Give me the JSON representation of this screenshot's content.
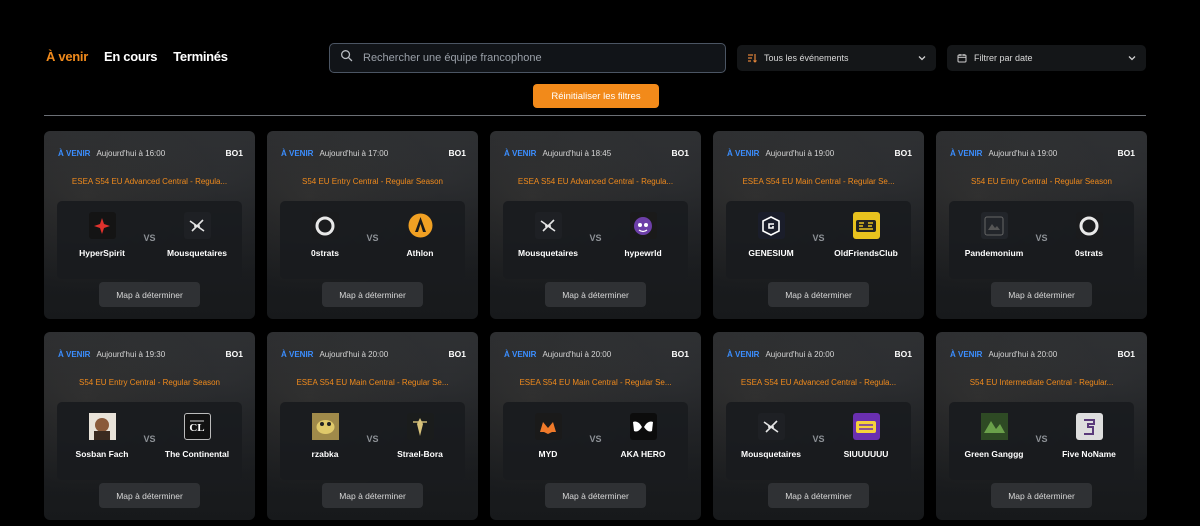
{
  "tabs": [
    {
      "label": "À venir",
      "active": true
    },
    {
      "label": "En cours",
      "active": false
    },
    {
      "label": "Terminés",
      "active": false
    }
  ],
  "search": {
    "placeholder": "Rechercher une équipe francophone",
    "value": ""
  },
  "filters": {
    "events_label": "Tous les événements",
    "date_label": "Filtrer par date",
    "reset_label": "Réinitialiser les filtres"
  },
  "colors": {
    "accent": "#f08a1c",
    "status": "#3b8eff"
  },
  "matches": [
    {
      "status": "À VENIR",
      "time": "Aujourd'hui à 16:00",
      "format": "BO1",
      "event": "ESEA S54 EU Advanced Central - Regula...",
      "team1": {
        "name": "HyperSpirit",
        "logo": "hyperspirit-logo"
      },
      "vs": "VS",
      "team2": {
        "name": "Mousquetaires",
        "logo": "mousquetaires-logo"
      },
      "map": "Map à déterminer"
    },
    {
      "status": "À VENIR",
      "time": "Aujourd'hui à 17:00",
      "format": "BO1",
      "event": "S54 EU Entry Central - Regular Season",
      "team1": {
        "name": "0strats",
        "logo": "0strats-logo"
      },
      "vs": "VS",
      "team2": {
        "name": "Athlon",
        "logo": "athlon-logo"
      },
      "map": "Map à déterminer"
    },
    {
      "status": "À VENIR",
      "time": "Aujourd'hui à 18:45",
      "format": "BO1",
      "event": "ESEA S54 EU Advanced Central - Regula...",
      "team1": {
        "name": "Mousquetaires",
        "logo": "mousquetaires-logo"
      },
      "vs": "VS",
      "team2": {
        "name": "hypewrld",
        "logo": "hypewrld-logo"
      },
      "map": "Map à déterminer"
    },
    {
      "status": "À VENIR",
      "time": "Aujourd'hui à 19:00",
      "format": "BO1",
      "event": "ESEA S54 EU Main Central - Regular Se...",
      "team1": {
        "name": "GENESIUM",
        "logo": "genesium-logo"
      },
      "vs": "VS",
      "team2": {
        "name": "OldFriendsClub",
        "logo": "oldfriendsclub-logo"
      },
      "map": "Map à déterminer"
    },
    {
      "status": "À VENIR",
      "time": "Aujourd'hui à 19:00",
      "format": "BO1",
      "event": "S54 EU Entry Central - Regular Season",
      "team1": {
        "name": "Pandemonium",
        "logo": "pandemonium-logo"
      },
      "vs": "VS",
      "team2": {
        "name": "0strats",
        "logo": "0strats-logo"
      },
      "map": "Map à déterminer"
    },
    {
      "status": "À VENIR",
      "time": "Aujourd'hui à 19:30",
      "format": "BO1",
      "event": "S54 EU Entry Central - Regular Season",
      "team1": {
        "name": "Sosban Fach",
        "logo": "sosban-fach-logo"
      },
      "vs": "VS",
      "team2": {
        "name": "The Continental",
        "logo": "the-continental-logo"
      },
      "map": "Map à déterminer"
    },
    {
      "status": "À VENIR",
      "time": "Aujourd'hui à 20:00",
      "format": "BO1",
      "event": "ESEA S54 EU Main Central - Regular Se...",
      "team1": {
        "name": "rzabka",
        "logo": "rzabka-logo"
      },
      "vs": "VS",
      "team2": {
        "name": "Strael-Bora",
        "logo": "strael-bora-logo"
      },
      "map": "Map à déterminer"
    },
    {
      "status": "À VENIR",
      "time": "Aujourd'hui à 20:00",
      "format": "BO1",
      "event": "ESEA S54 EU Main Central - Regular Se...",
      "team1": {
        "name": "MYD",
        "logo": "myd-logo"
      },
      "vs": "VS",
      "team2": {
        "name": "AKA HERO",
        "logo": "aka-hero-logo"
      },
      "map": "Map à déterminer"
    },
    {
      "status": "À VENIR",
      "time": "Aujourd'hui à 20:00",
      "format": "BO1",
      "event": "ESEA S54 EU Advanced Central - Regula...",
      "team1": {
        "name": "Mousquetaires",
        "logo": "mousquetaires-logo"
      },
      "vs": "VS",
      "team2": {
        "name": "SIUUUUUU",
        "logo": "siuuuuuu-logo"
      },
      "map": "Map à déterminer"
    },
    {
      "status": "À VENIR",
      "time": "Aujourd'hui à 20:00",
      "format": "BO1",
      "event": "S54 EU Intermediate Central - Regular...",
      "team1": {
        "name": "Green Ganggg",
        "logo": "green-ganggg-logo"
      },
      "vs": "VS",
      "team2": {
        "name": "Five NoName",
        "logo": "five-noname-logo"
      },
      "map": "Map à déterminer"
    }
  ]
}
